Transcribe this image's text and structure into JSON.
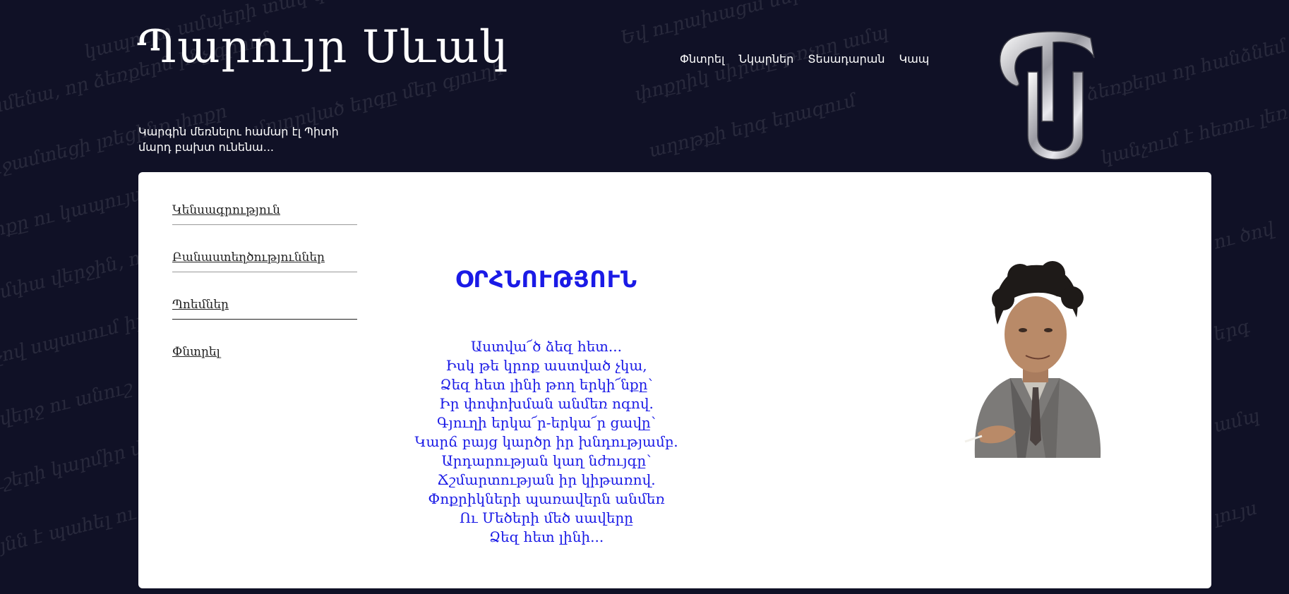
{
  "header": {
    "site_title": "Պարույր Սևակ",
    "tagline": "Կարգին մեռնելու համար էլ Պիտի մարդ բախտ ունենա..."
  },
  "top_nav": {
    "items": [
      {
        "label": "Փնտրել"
      },
      {
        "label": "Նկարներ"
      },
      {
        "label": "Տեսադարան"
      },
      {
        "label": "Կապ"
      }
    ]
  },
  "logo": {
    "icon": "ps-monogram-logo"
  },
  "side_menu": {
    "items": [
      {
        "label": "Կենսագրություն"
      },
      {
        "label": "Բանաստեղծություններ"
      },
      {
        "label": "Պոեմներ"
      },
      {
        "label": "Փնտրել"
      }
    ]
  },
  "poem": {
    "title": "ՕՐՀՆՈՒԹՅՈՒՆ",
    "lines": [
      "Աստվա՜ծ ձեզ հետ...",
      "Իսկ թե կրոք աստված չկա,",
      "Ձեզ հետ լինի թող երկի՜նքը՝",
      "Իր փոփոխման անմեռ ոգով.",
      "Գյուղի երկա՜ր-երկա՜ր ցավը՝",
      "Կարճ բայց կարծր իր խնդությամբ.",
      "Արդարության կաղ նժույգը՝",
      "Ճշմարտության իր կիթառով.",
      "Փոքրիկների պառավերն անմեռ",
      "Ու Մեծերի մեծ սավերը",
      "Ձեզ հետ լինի..."
    ]
  },
  "portrait": {
    "icon": "poet-portrait-image"
  },
  "colors": {
    "background": "#101126",
    "panel": "#ffffff",
    "poem_text": "#1a1ae6",
    "menu_text": "#222222"
  }
}
